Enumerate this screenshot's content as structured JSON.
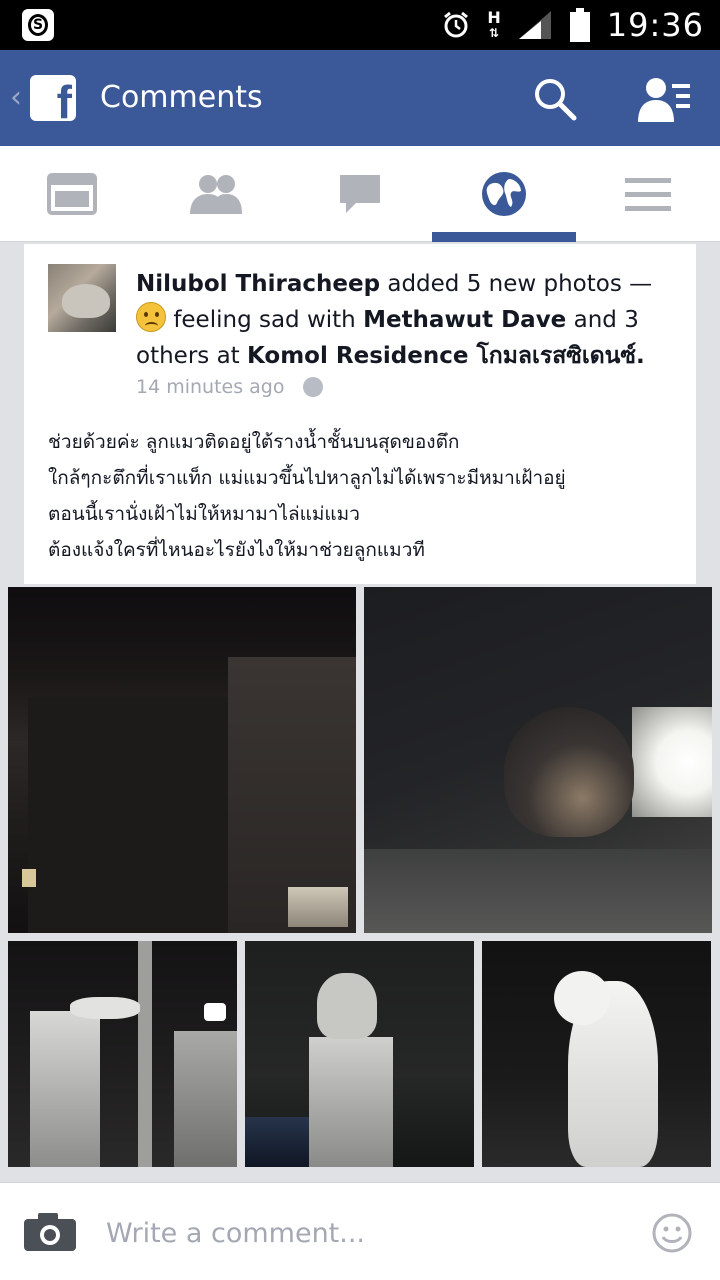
{
  "status_bar": {
    "time": "19:36",
    "network": "H",
    "icons": [
      "skype-icon",
      "alarm-icon",
      "network-h-icon",
      "signal-icon",
      "battery-icon"
    ]
  },
  "header": {
    "title": "Comments",
    "brand_color": "#3b5998",
    "icons": [
      "back-chevron-icon",
      "facebook-logo-icon",
      "search-icon",
      "friend-requests-icon"
    ]
  },
  "nav": {
    "tabs": [
      {
        "name": "news-feed",
        "icon": "news-feed-icon"
      },
      {
        "name": "friends",
        "icon": "friends-icon"
      },
      {
        "name": "messages",
        "icon": "messages-icon"
      },
      {
        "name": "notifications",
        "icon": "globe-icon",
        "active": true
      },
      {
        "name": "more",
        "icon": "menu-icon"
      }
    ]
  },
  "post": {
    "author": "Nilubol Thiracheep",
    "action": "added 5 new photos —",
    "feeling_prefix": "feeling sad with",
    "tagged": "Methawut Dave",
    "and_others": "and 3 others at",
    "location": "Komol Residence โกมลเรสซิเดนซ์.",
    "timestamp": "14 minutes ago",
    "text_lines": [
      "ช่วยด้วยค่ะ ลูกแมวติดอยู่ใต้รางน้ำชั้นบนสุดของตึก",
      "ใกล้ๆกะตึกที่เราแท็ก แม่แมวขึ้นไปหาลูกไม่ได้เพราะมีหมาเฝ้าอยู่",
      "ตอนนี้เรานั่งเฝ้าไม่ให้หมามาไล่แม่แมว",
      "ต้องแจ้งใครที่ไหนอะไรยังไงให้มาช่วยลูกแมวที"
    ],
    "photo_count": 5
  },
  "comment_bar": {
    "placeholder": "Write a comment..."
  }
}
